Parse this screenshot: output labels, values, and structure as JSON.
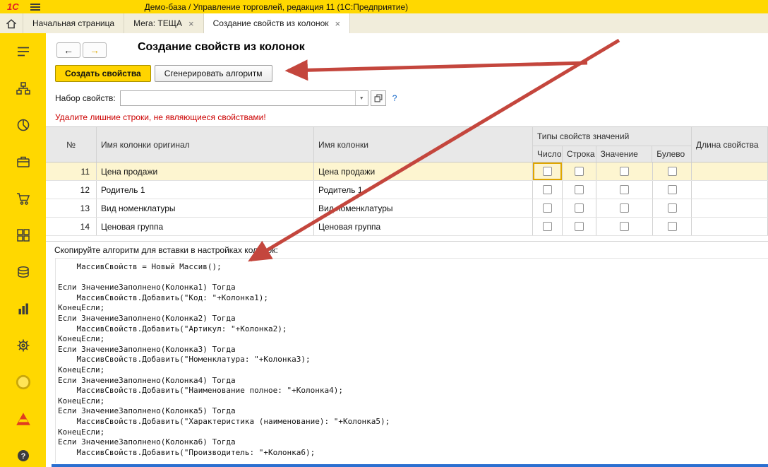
{
  "window": {
    "logo": "1С",
    "title": "Демо-база / Управление торговлей, редакция 11  (1С:Предприятие)"
  },
  "tabs": {
    "home_label": "Начальная страница",
    "close_glyph": "×",
    "items": [
      {
        "label": "Мега: ТЕЩА"
      },
      {
        "label": "Создание свойств из колонок"
      }
    ]
  },
  "sidebar": {
    "icons": [
      "menu",
      "structure",
      "pie-chart",
      "briefcase",
      "cart",
      "modules",
      "money",
      "report",
      "settings",
      "marker-circle",
      "pyramid",
      "help"
    ]
  },
  "nav": {
    "back": "←",
    "forward": "→"
  },
  "page": {
    "title": "Создание свойств из колонок",
    "create_button": "Создать свойства",
    "generate_button": "Сгенерировать алгоритм",
    "propset_label": "Набор свойств:",
    "propset_value": "",
    "dropdown_glyph": "▼",
    "help_link": "?",
    "warning": "Удалите лишние строки, не являющиеся свойствами!",
    "copy_hint": "Скопируйте алгоритм для вставки в настройках колонок:"
  },
  "table": {
    "headers": {
      "num": "№",
      "col_original": "Имя колонки оригинал",
      "col_name": "Имя колонки",
      "types_group": "Типы свойств значений",
      "type_number": "Число",
      "type_string": "Строка",
      "type_value": "Значение",
      "type_bool": "Булево",
      "length": "Длина свойства"
    },
    "rows": [
      {
        "num": "11",
        "original": "Цена продажи",
        "name": "Цена продажи"
      },
      {
        "num": "12",
        "original": "Родитель 1",
        "name": "Родитель 1"
      },
      {
        "num": "13",
        "original": "Вид номенклатуры",
        "name": "Вид номенклатуры"
      },
      {
        "num": "14",
        "original": "Ценовая группа",
        "name": "Ценовая группа"
      }
    ]
  },
  "code": {
    "text": "    МассивСвойств = Новый Массив();\n\nЕсли ЗначениеЗаполнено(Колонка1) Тогда\n    МассивСвойств.Добавить(\"Код: \"+Колонка1);\nКонецЕсли;\nЕсли ЗначениеЗаполнено(Колонка2) Тогда\n    МассивСвойств.Добавить(\"Артикул: \"+Колонка2);\nКонецЕсли;\nЕсли ЗначениеЗаполнено(Колонка3) Тогда\n    МассивСвойств.Добавить(\"Номенклатура: \"+Колонка3);\nКонецЕсли;\nЕсли ЗначениеЗаполнено(Колонка4) Тогда\n    МассивСвойств.Добавить(\"Наименование полное: \"+Колонка4);\nКонецЕсли;\nЕсли ЗначениеЗаполнено(Колонка5) Тогда\n    МассивСвойств.Добавить(\"Характеристика (наименование): \"+Колонка5);\nКонецЕсли;\nЕсли ЗначениеЗаполнено(Колонка6) Тогда\n    МассивСвойств.Добавить(\"Производитель: \"+Колонка6);"
  },
  "colors": {
    "brand_yellow": "#ffd800",
    "tabbar_beige": "#f1eddb",
    "selected_row": "#fdf5d0",
    "focus_cell": "#dfa600",
    "warning_red": "#cc0000",
    "arrow_red": "#c4463d",
    "help_blue": "#0f64c8",
    "bottom_bar_blue": "#2b6fd0"
  }
}
